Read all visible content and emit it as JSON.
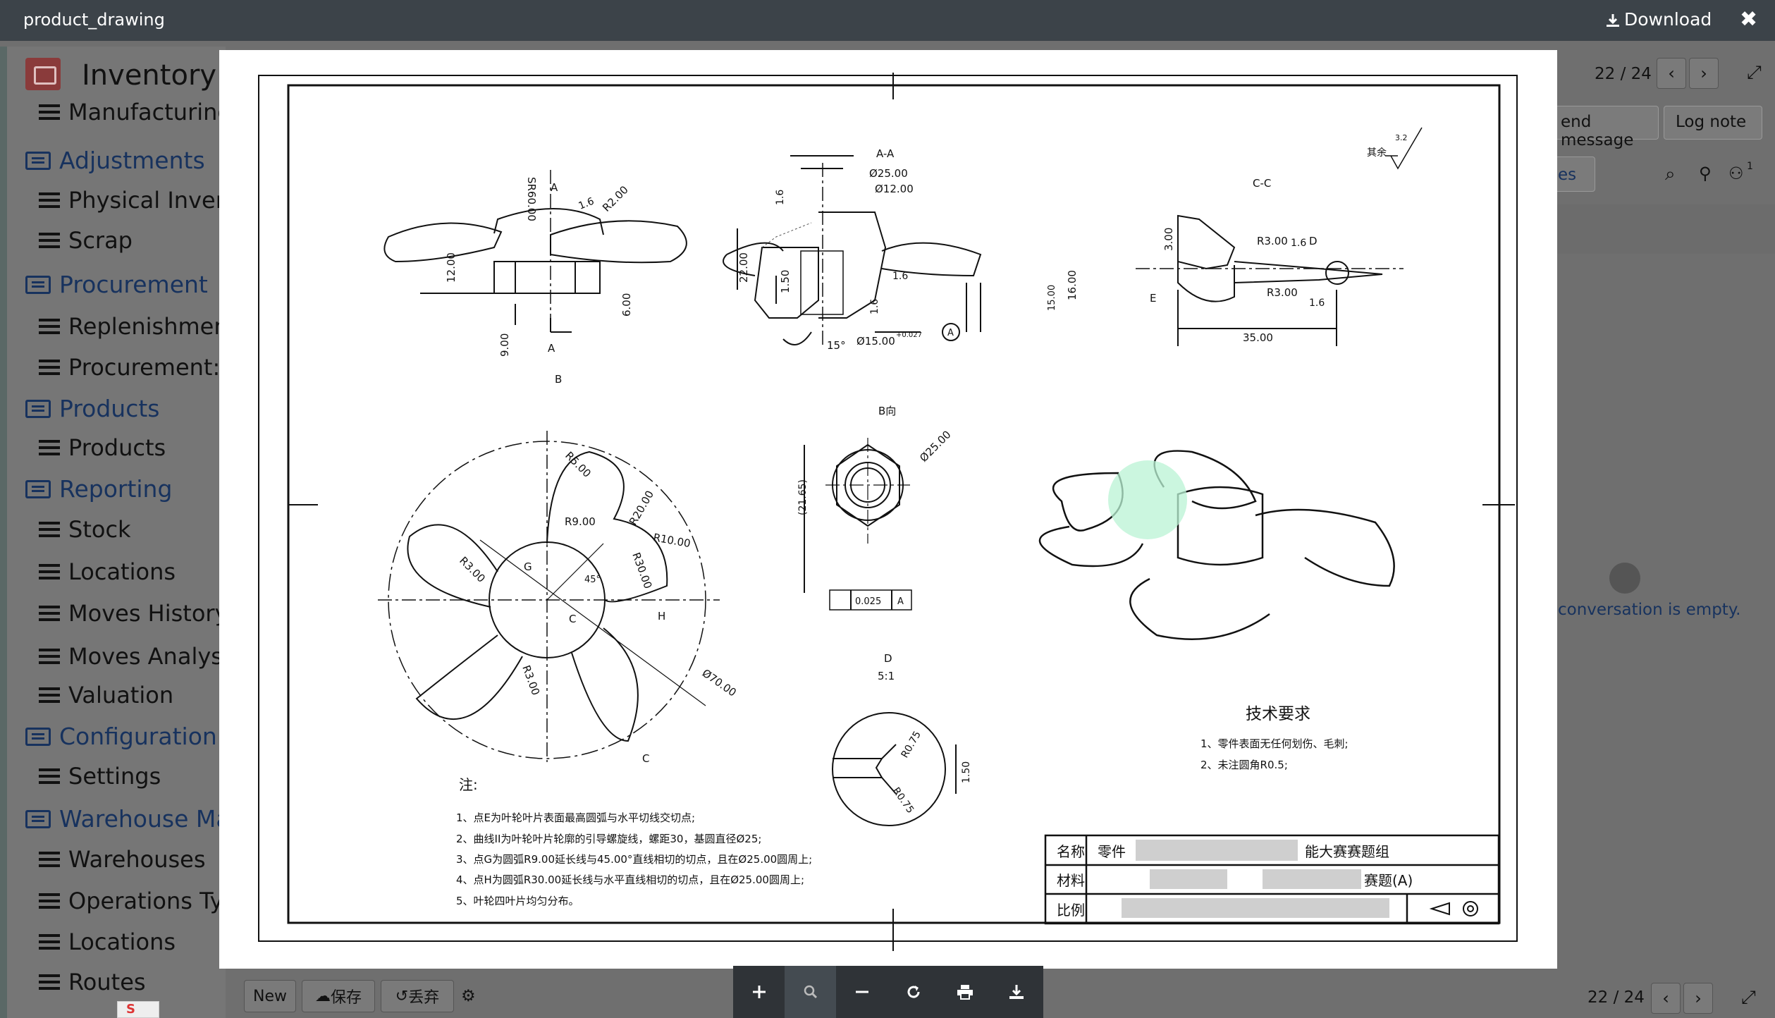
{
  "window": {
    "title": "product_drawing",
    "download_label": "Download",
    "close_label": "✖"
  },
  "sidebar": {
    "app_title": "Inventory",
    "items": [
      {
        "kind": "item",
        "label": "Manufacturing"
      },
      {
        "kind": "section",
        "label": "Adjustments"
      },
      {
        "kind": "item",
        "label": "Physical Inventory"
      },
      {
        "kind": "item",
        "label": "Scrap"
      },
      {
        "kind": "section",
        "label": "Procurement"
      },
      {
        "kind": "item",
        "label": "Replenishment"
      },
      {
        "kind": "item",
        "label": "Procurement: r"
      },
      {
        "kind": "section",
        "label": "Products"
      },
      {
        "kind": "item",
        "label": "Products"
      },
      {
        "kind": "section",
        "label": "Reporting"
      },
      {
        "kind": "item",
        "label": "Stock"
      },
      {
        "kind": "item",
        "label": "Locations"
      },
      {
        "kind": "item",
        "label": "Moves History"
      },
      {
        "kind": "item",
        "label": "Moves Analysis"
      },
      {
        "kind": "item",
        "label": "Valuation"
      },
      {
        "kind": "section",
        "label": "Configuration"
      },
      {
        "kind": "item",
        "label": "Settings"
      },
      {
        "kind": "section",
        "label": "Warehouse Ma"
      },
      {
        "kind": "item",
        "label": "Warehouses"
      },
      {
        "kind": "item",
        "label": "Operations Typ"
      },
      {
        "kind": "item",
        "label": "Locations"
      },
      {
        "kind": "item",
        "label": "Routes"
      }
    ]
  },
  "record_pager": {
    "top": "22 / 24",
    "bottom": "22 / 24"
  },
  "chatter": {
    "send_message": "end message",
    "log_note": "Log note",
    "tab_partial": "es",
    "followers_count": "1",
    "empty_text": "conversation is empty."
  },
  "form_buttons": {
    "new": "New",
    "save": "保存",
    "discard": "丢弃"
  },
  "drawing": {
    "sec_aa": "A-A",
    "sec_cc": "C-C",
    "view_b": "B向",
    "view_d": "D",
    "view_d_scale": "5:1",
    "roughness_other": "其余",
    "roughness_val": "3.2",
    "dims": {
      "d25": "Ø25.00",
      "d12": "Ø12.00",
      "d15": "Ø15.00",
      "d15_tol": "+0.027",
      "h22": "22.00",
      "h150": "1.50",
      "h15": "15.00",
      "h16": "16.00",
      "h16r": "1.6",
      "ang15": "15°",
      "datum_a": "A",
      "sr60": "SR60.00",
      "r2": "R2.00",
      "h12": "12.00",
      "h9": "9.00",
      "h6": "6.00",
      "r3c": "R3.00",
      "r3c2": "R3.00",
      "l35": "35.00",
      "h3": "3.00",
      "lbl_d": "D",
      "lbl_e": "E",
      "r5": "R5.00",
      "r9": "R9.00",
      "r20": "R20.00",
      "r10": "R10.00",
      "r30": "R30.00",
      "r3a": "R3.00",
      "r3b": "R3.00",
      "d70": "Ø70.00",
      "ang45": "45°",
      "lbl_g": "G",
      "lbl_c": "C",
      "lbl_h": "H",
      "hex_w": "(21.65)",
      "hex_d": "Ø25.00",
      "flat": "0.025",
      "r075a": "R0.75",
      "r075b": "R0.75",
      "h150d": "1.50"
    },
    "tech_title": "技术要求",
    "tech_req": [
      "1、零件表面无任何划伤、毛刺;",
      "2、未注圆角R0.5;"
    ],
    "notes_title": "注:",
    "notes": [
      "1、点E为叶轮叶片表面最高圆弧与水平切线交切点;",
      "2、曲线II为叶轮叶片轮廓的引导螺旋线，螺距30，基圆直径Ø25;",
      "3、点G为圆弧R9.00延长线与45.00°直线相切的切点，且在Ø25.00圆周上;",
      "4、点H为圆弧R30.00延长线与水平直线相切的切点，且在Ø25.00圆周上;",
      "5、叶轮四叶片均匀分布。"
    ],
    "title_block": {
      "name_label": "名称",
      "name_val": "零件",
      "contest": "能大赛赛题组",
      "material_label": "材料",
      "variant": "赛题(A)",
      "scale_label": "比例"
    }
  },
  "colors": {
    "topbar": "#3c4349",
    "link": "#17325e",
    "overlay": "#6f6f6f"
  }
}
